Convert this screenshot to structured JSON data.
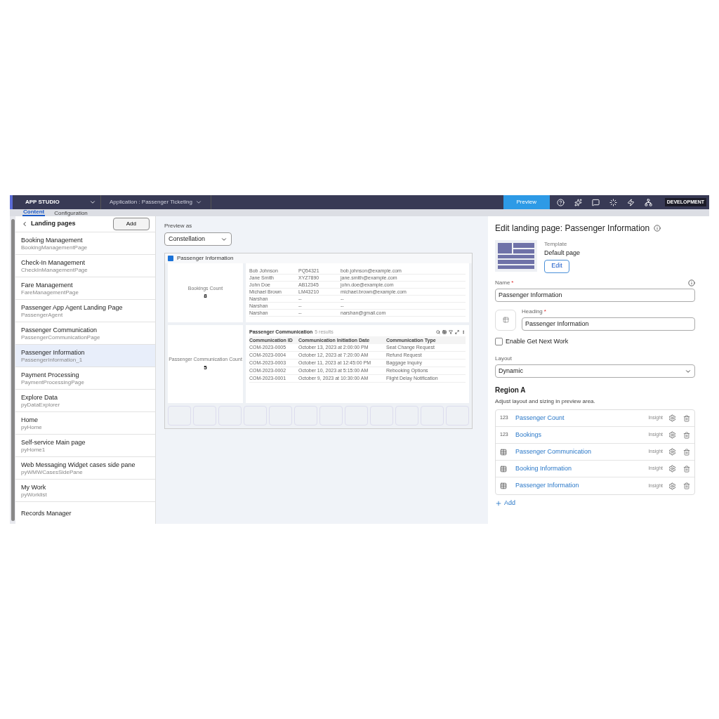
{
  "topbar": {
    "studio": "APP STUDIO",
    "application": "Application :  Passenger Ticketing",
    "preview": "Preview",
    "environment": "DEVELOPMENT"
  },
  "tabs": [
    {
      "label": "Content",
      "selected": true
    },
    {
      "label": "Configuration",
      "selected": false
    }
  ],
  "sidebar": {
    "title": "Landing pages",
    "add": "Add",
    "items": [
      {
        "title": "Booking Management",
        "sub": "BookingManagementPage",
        "selected": false
      },
      {
        "title": "Check-In Management",
        "sub": "CheckInManagementPage",
        "selected": false
      },
      {
        "title": "Fare Management",
        "sub": "FareManagementPage",
        "selected": false
      },
      {
        "title": "Passenger App Agent Landing Page",
        "sub": "PassengerAgent",
        "selected": false
      },
      {
        "title": "Passenger Communication",
        "sub": "PassengerCommunicationPage",
        "selected": false
      },
      {
        "title": "Passenger Information",
        "sub": "PassengerInformation_1",
        "selected": true
      },
      {
        "title": "Payment Processing",
        "sub": "PaymentProcessingPage",
        "selected": false
      },
      {
        "title": "Explore Data",
        "sub": "pyDataExplorer",
        "selected": false
      },
      {
        "title": "Home",
        "sub": "pyHome",
        "selected": false
      },
      {
        "title": "Self-service Main page",
        "sub": "pyHome1",
        "selected": false
      },
      {
        "title": "Web Messaging Widget cases side pane",
        "sub": "pyWMWCasesSidePane",
        "selected": false
      },
      {
        "title": "My Work",
        "sub": "pyWorklist",
        "selected": false
      },
      {
        "title": "Records Manager",
        "selected": false
      }
    ]
  },
  "preview": {
    "label": "Preview as",
    "option": "Constellation",
    "page_title": "Passenger Information",
    "bookings_label": "Bookings Count",
    "bookings_value": "8",
    "booking_rows": [
      [
        "Bob Johnson",
        "PQ54321",
        "bob.johnson@example.com"
      ],
      [
        "Jane Smith",
        "XYZ7890",
        "jane.smith@example.com"
      ],
      [
        "John Doe",
        "AB12345",
        "john.doe@example.com"
      ],
      [
        "Michael Brown",
        "LM43210",
        "michael.brown@example.com"
      ],
      [
        "Narshan",
        "--",
        "--"
      ],
      [
        "Narshan",
        "--",
        "--"
      ],
      [
        "Narshan",
        "--",
        "narshan@gmail.com"
      ]
    ],
    "comm_label": "Passenger Communication Count",
    "comm_value": "5",
    "comm_title": "Passenger Communication",
    "comm_count": "5 results",
    "comm_columns": [
      "Communication ID",
      "Communication Initiation Date",
      "Communication Type"
    ],
    "comm_rows": [
      [
        "COM-2023-0005",
        "October 13, 2023 at 2:00:00 PM",
        "Seat Change Request"
      ],
      [
        "COM-2023-0004",
        "October 12, 2023 at 7:20:00 AM",
        "Refund Request"
      ],
      [
        "COM-2023-0003",
        "October 11, 2023 at 12:45:00 PM",
        "Baggage Inquiry"
      ],
      [
        "COM-2023-0002",
        "October 10, 2023 at 5:15:00 AM",
        "Rebooking Options"
      ],
      [
        "COM-2023-0001",
        "October 9, 2023 at 10:30:00 AM",
        "Flight Delay Notification"
      ]
    ]
  },
  "editor": {
    "title": "Edit landing page: Passenger Information",
    "template_label": "Template",
    "template_value": "Default page",
    "edit": "Edit",
    "name_label": "Name",
    "name_required": "*",
    "heading_required": "*",
    "name_value": "Passenger Information",
    "heading_label": "Heading",
    "heading_value": "Passenger Information",
    "get_next_work": {
      "label": "Enable Get Next Work",
      "checked": false
    },
    "layout_label": "Layout",
    "layout_value": "Dynamic",
    "region_title": "Region A",
    "region_hint": "Adjust layout and sizing in preview area.",
    "widgets": [
      {
        "kind": "number",
        "badge": "123",
        "name": "Passenger Count",
        "type": "Insight"
      },
      {
        "kind": "number",
        "badge": "123",
        "name": "Bookings",
        "type": "Insight"
      },
      {
        "kind": "table",
        "name": "Passenger Communication",
        "type": "Insight"
      },
      {
        "kind": "table",
        "name": "Booking Information",
        "type": "Insight"
      },
      {
        "kind": "table",
        "name": "Passenger Information",
        "type": "Insight"
      }
    ],
    "add": "Add"
  }
}
